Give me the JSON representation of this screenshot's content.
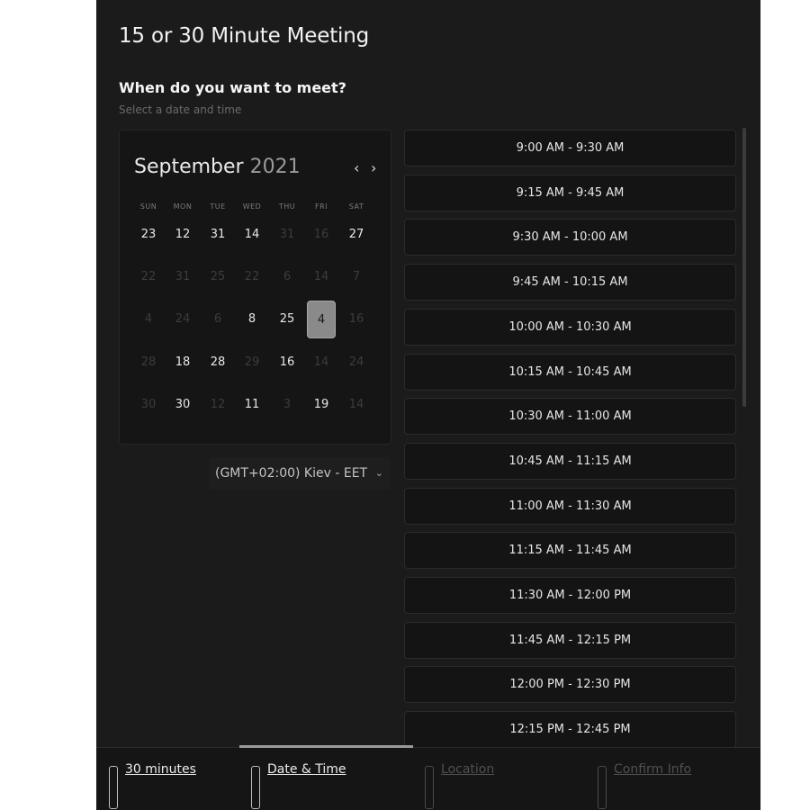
{
  "title": "15 or 30 Minute Meeting",
  "question": "When do you want to meet?",
  "subtitle": "Select a date and time",
  "calendar": {
    "month": "September",
    "year": "2021",
    "prev_icon": "‹",
    "next_icon": "›",
    "weekdays": [
      "SUN",
      "MON",
      "TUE",
      "WED",
      "THU",
      "FRI",
      "SAT"
    ],
    "weeks": [
      [
        {
          "d": "23",
          "s": "on"
        },
        {
          "d": "12",
          "s": "on"
        },
        {
          "d": "31",
          "s": "on"
        },
        {
          "d": "14",
          "s": "on"
        },
        {
          "d": "31",
          "s": "off"
        },
        {
          "d": "16",
          "s": "off"
        },
        {
          "d": "27",
          "s": "on"
        }
      ],
      [
        {
          "d": "22",
          "s": "off"
        },
        {
          "d": "31",
          "s": "off"
        },
        {
          "d": "25",
          "s": "off"
        },
        {
          "d": "22",
          "s": "off"
        },
        {
          "d": "6",
          "s": "off"
        },
        {
          "d": "14",
          "s": "off"
        },
        {
          "d": "7",
          "s": "off"
        }
      ],
      [
        {
          "d": "4",
          "s": "off"
        },
        {
          "d": "24",
          "s": "off"
        },
        {
          "d": "6",
          "s": "off"
        },
        {
          "d": "8",
          "s": "on"
        },
        {
          "d": "25",
          "s": "on"
        },
        {
          "d": "4",
          "s": "sel"
        },
        {
          "d": "16",
          "s": "off"
        }
      ],
      [
        {
          "d": "28",
          "s": "off"
        },
        {
          "d": "18",
          "s": "on"
        },
        {
          "d": "28",
          "s": "on"
        },
        {
          "d": "29",
          "s": "off"
        },
        {
          "d": "16",
          "s": "on"
        },
        {
          "d": "14",
          "s": "off"
        },
        {
          "d": "24",
          "s": "off"
        }
      ],
      [
        {
          "d": "30",
          "s": "off"
        },
        {
          "d": "30",
          "s": "on"
        },
        {
          "d": "12",
          "s": "off"
        },
        {
          "d": "11",
          "s": "on"
        },
        {
          "d": "3",
          "s": "off"
        },
        {
          "d": "19",
          "s": "on"
        },
        {
          "d": "14",
          "s": "off"
        }
      ]
    ]
  },
  "timezone": {
    "label": "(GMT+02:00) Kiev - EET",
    "chevron_icon": "chevron-down-icon"
  },
  "time_slots": [
    "9:00 AM - 9:30 AM",
    "9:15 AM - 9:45 AM",
    "9:30 AM - 10:00 AM",
    "9:45 AM - 10:15 AM",
    "10:00 AM - 10:30 AM",
    "10:15 AM - 10:45 AM",
    "10:30 AM - 11:00 AM",
    "10:45 AM - 11:15 AM",
    "11:00 AM - 11:30 AM",
    "11:15 AM - 11:45 AM",
    "11:30 AM - 12:00 PM",
    "11:45 AM - 12:15 PM",
    "12:00 PM - 12:30 PM",
    "12:15 PM - 12:45 PM"
  ],
  "steps": [
    {
      "label": "30 minutes",
      "state": "active"
    },
    {
      "label": "Date & Time",
      "state": "active"
    },
    {
      "label": "Location",
      "state": "dim"
    },
    {
      "label": "Confirm Info",
      "state": "dim"
    }
  ],
  "colors": {
    "panel_bg": "#1b1b1b",
    "selected_day": "#8a8a8a",
    "slot_border": "#2b2b2b"
  }
}
